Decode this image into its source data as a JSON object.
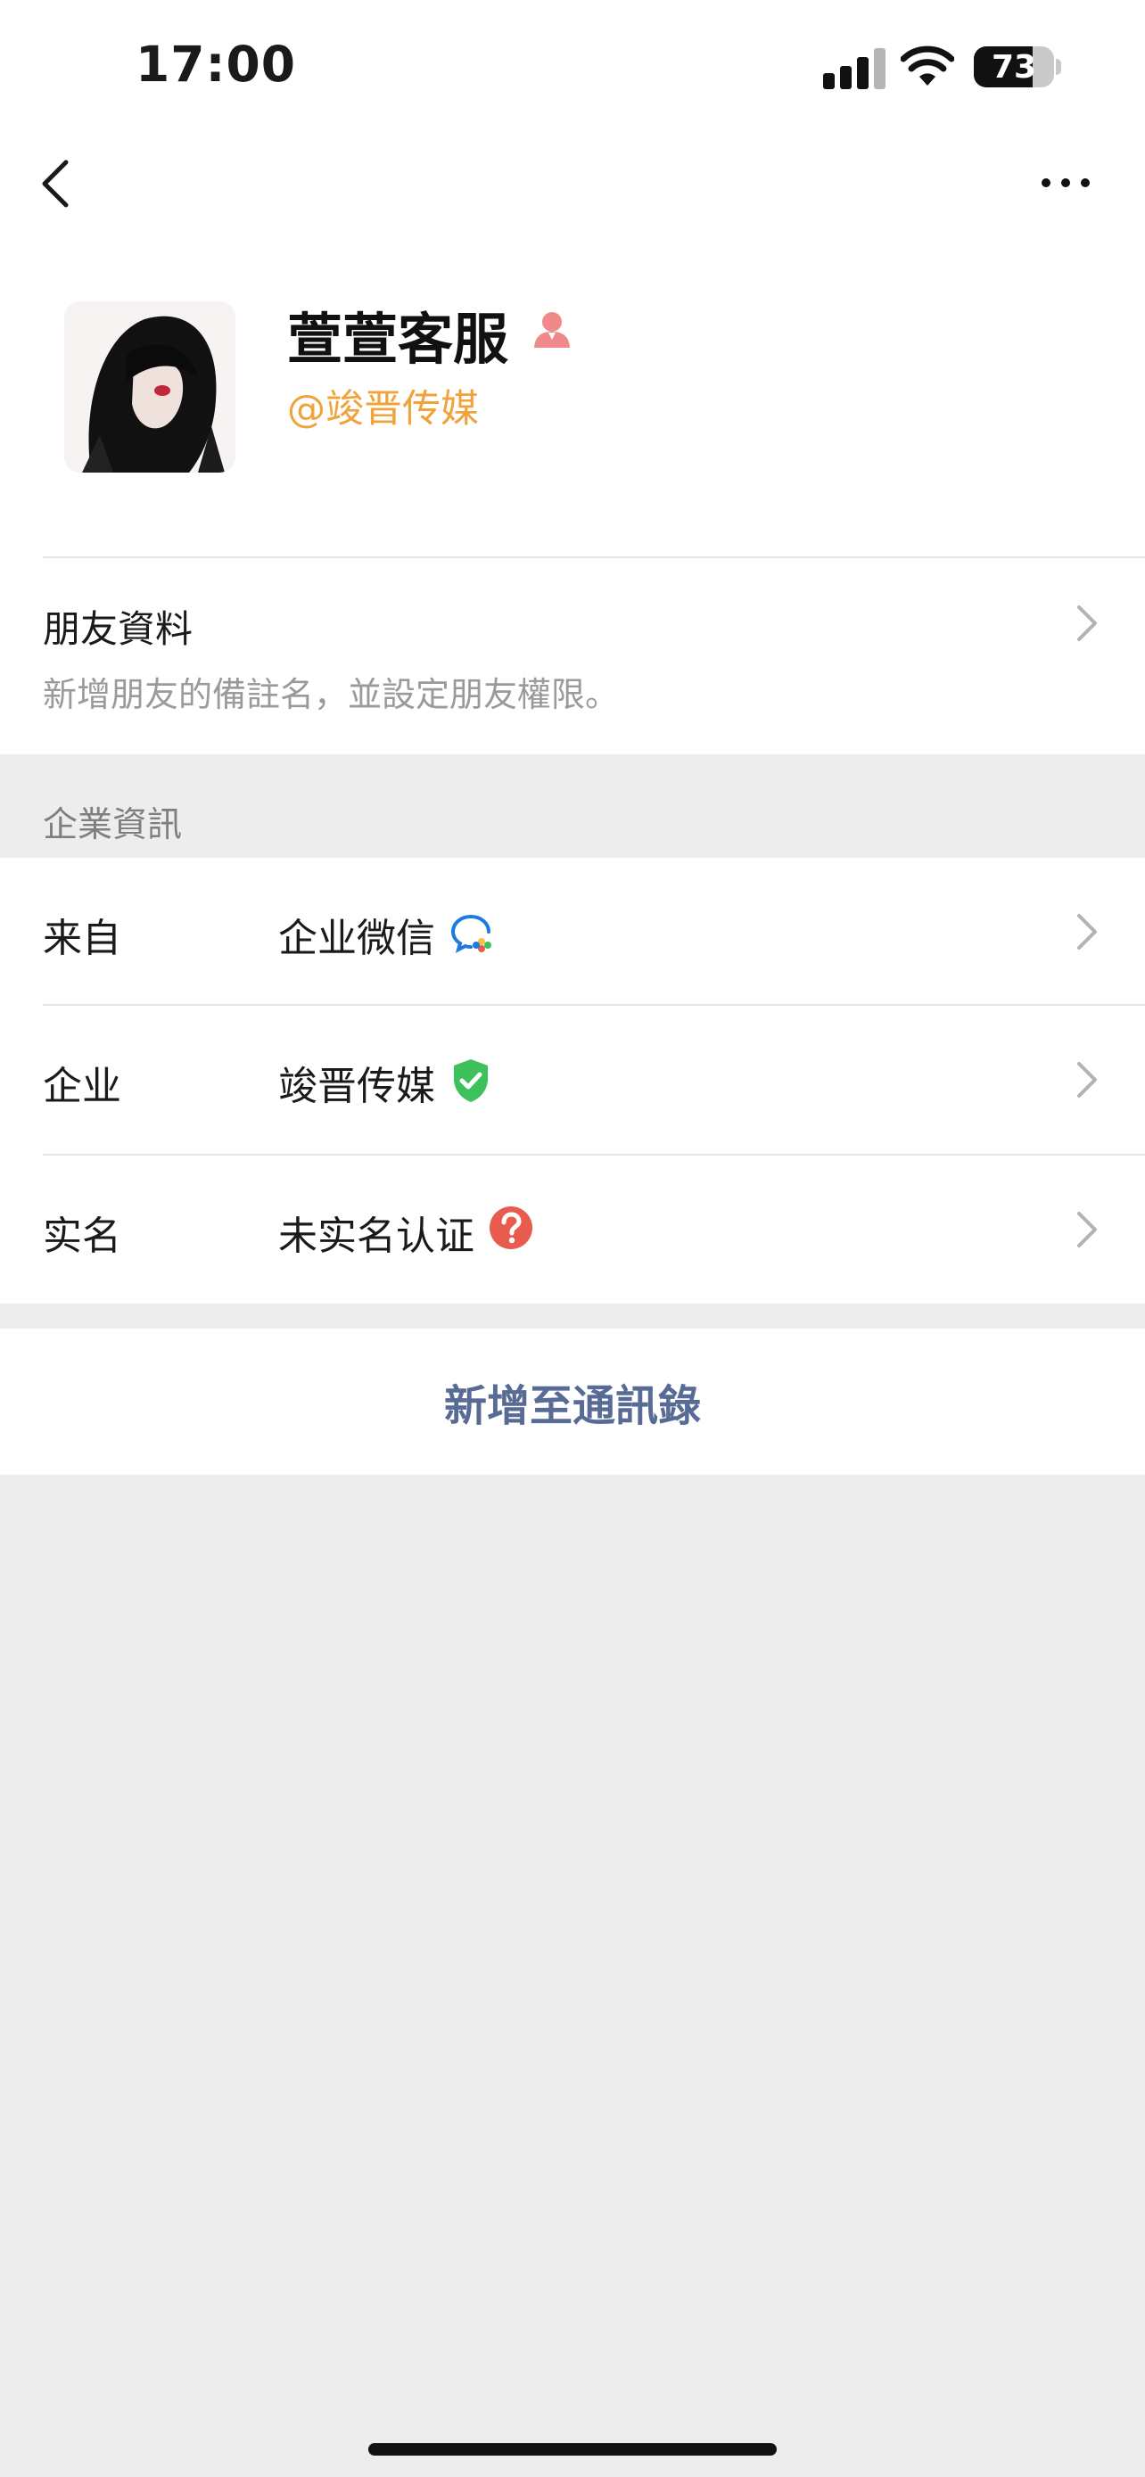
{
  "status_bar": {
    "time": "17:00",
    "battery": "73",
    "battery_level": 0.73
  },
  "profile": {
    "name": "萱萱客服",
    "company_tag": "@竣晋传媒"
  },
  "friend_info": {
    "title": "朋友資料",
    "subtitle": "新增朋友的備註名，並設定朋友權限。"
  },
  "enterprise": {
    "section_title": "企業資訊",
    "rows": [
      {
        "label": "来自",
        "value": "企业微信"
      },
      {
        "label": "企业",
        "value": "竣晋传媒"
      },
      {
        "label": "实名",
        "value": "未实名认证"
      }
    ]
  },
  "actions": {
    "add_to_contacts": "新增至通訊錄"
  },
  "colors": {
    "accent_orange": "#f0a33b",
    "link_blue": "#576b95",
    "verified_green": "#3cc15b",
    "warning_red": "#e85b4f"
  }
}
